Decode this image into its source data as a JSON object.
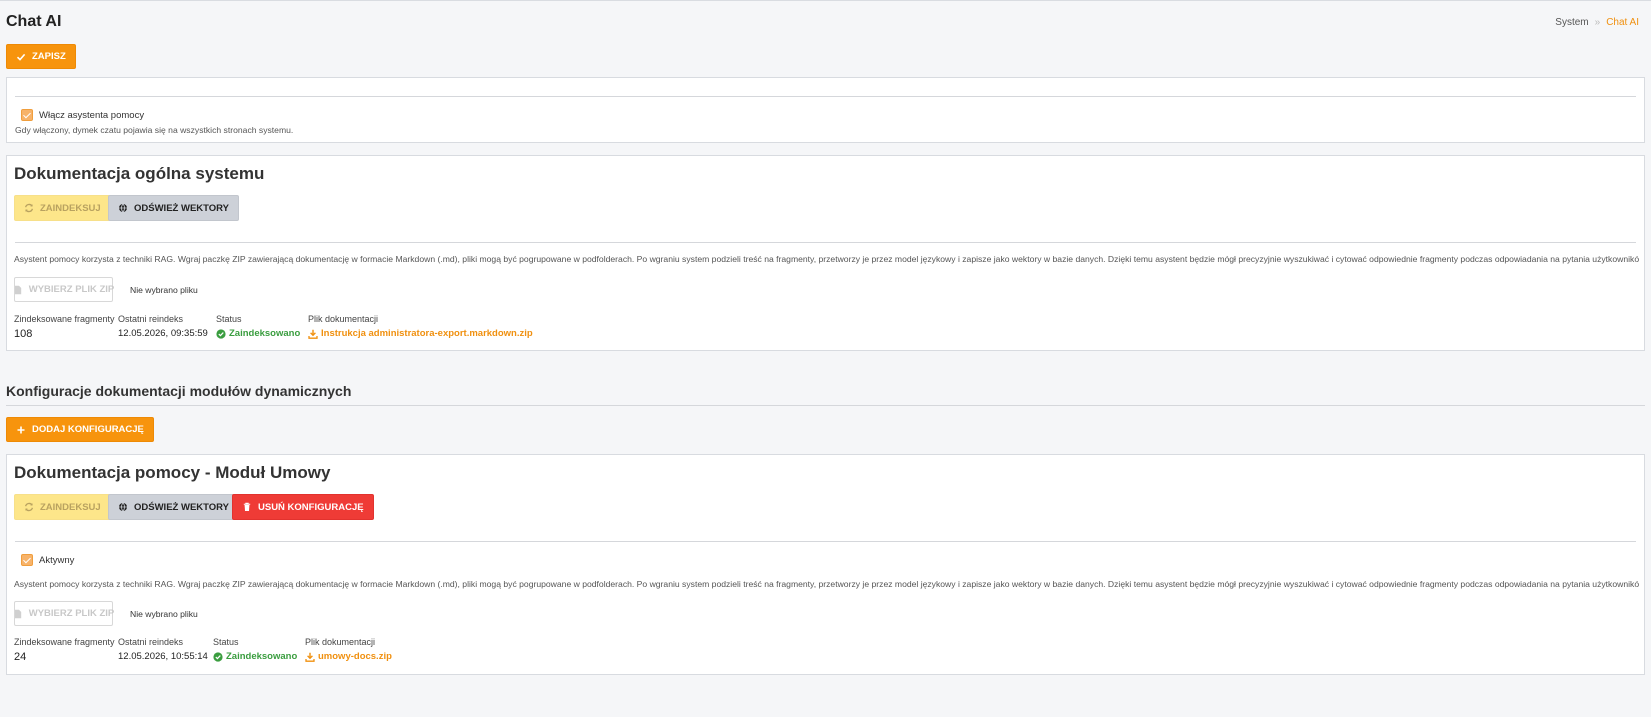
{
  "header": {
    "title": "Chat AI",
    "breadcrumb": [
      "System",
      "Chat AI"
    ]
  },
  "toolbar": {
    "save_label": "ZAPISZ"
  },
  "assistant": {
    "enable_label": "Włącz asystenta pomocy",
    "enable_checked": true,
    "hint": "Gdy włączony, dymek czatu pojawia się na wszystkich stronach systemu."
  },
  "general_doc": {
    "title": "Dokumentacja ogólna systemu",
    "index_label": "ZAINDEKSUJ",
    "refresh_label": "ODŚWIEŻ WEKTORY",
    "description": "Asystent pomocy korzysta z techniki RAG. Wgraj paczkę ZIP zawierającą dokumentację w formacie Markdown (.md), pliki mogą być pogrupowane w podfolderach. Po wgraniu system podzieli treść na fragmenty, przetworzy je przez model językowy i zapisze jako wektory w bazie danych. Dzięki temu asystent będzie mógł precyzyjnie wyszukiwać i cytować odpowiednie fragmenty podczas odpowiadania na pytania użytkowników.",
    "file_button": "WYBIERZ PLIK ZIP",
    "file_status": "Nie wybrano pliku",
    "stats": {
      "fragments_label": "Zindeksowane fragmenty",
      "fragments_value": "108",
      "reindex_label": "Ostatni reindeks",
      "reindex_value": "12.05.2026, 09:35:59",
      "status_label": "Status",
      "status_value": "Zaindeksowano",
      "file_label": "Plik dokumentacji",
      "file_value": "Instrukcja administratora-export.markdown.zip"
    }
  },
  "modules": {
    "title": "Konfiguracje dokumentacji modułów dynamicznych",
    "add_label": "DODAJ KONFIGURACJĘ",
    "items": [
      {
        "title": "Dokumentacja pomocy - Moduł Umowy",
        "index_label": "ZAINDEKSUJ",
        "refresh_label": "ODŚWIEŻ WEKTORY",
        "delete_label": "USUŃ KONFIGURACJĘ",
        "active_label": "Aktywny",
        "active_checked": true,
        "description": "Asystent pomocy korzysta z techniki RAG. Wgraj paczkę ZIP zawierającą dokumentację w formacie Markdown (.md), pliki mogą być pogrupowane w podfolderach. Po wgraniu system podzieli treść na fragmenty, przetworzy je przez model językowy i zapisze jako wektory w bazie danych. Dzięki temu asystent będzie mógł precyzyjnie wyszukiwać i cytować odpowiednie fragmenty podczas odpowiadania na pytania użytkowników.",
        "file_button": "WYBIERZ PLIK ZIP",
        "file_status": "Nie wybrano pliku",
        "stats": {
          "fragments_label": "Zindeksowane fragmenty",
          "fragments_value": "24",
          "reindex_label": "Ostatni reindeks",
          "reindex_value": "12.05.2026, 10:55:14",
          "status_label": "Status",
          "status_value": "Zaindeksowano",
          "file_label": "Plik dokumentacji",
          "file_value": "umowy-docs.zip"
        }
      }
    ]
  },
  "icons": {
    "save": "check-icon",
    "index": "sync-icon",
    "refresh": "globe-icon",
    "delete": "trash-icon",
    "file": "file-icon",
    "add": "plus-icon",
    "status": "check-circle-icon",
    "download": "download-icon"
  },
  "colors": {
    "accent": "#f7940d",
    "danger": "#ef3b36",
    "success": "#3a9d3f",
    "link": "#f0900f"
  }
}
